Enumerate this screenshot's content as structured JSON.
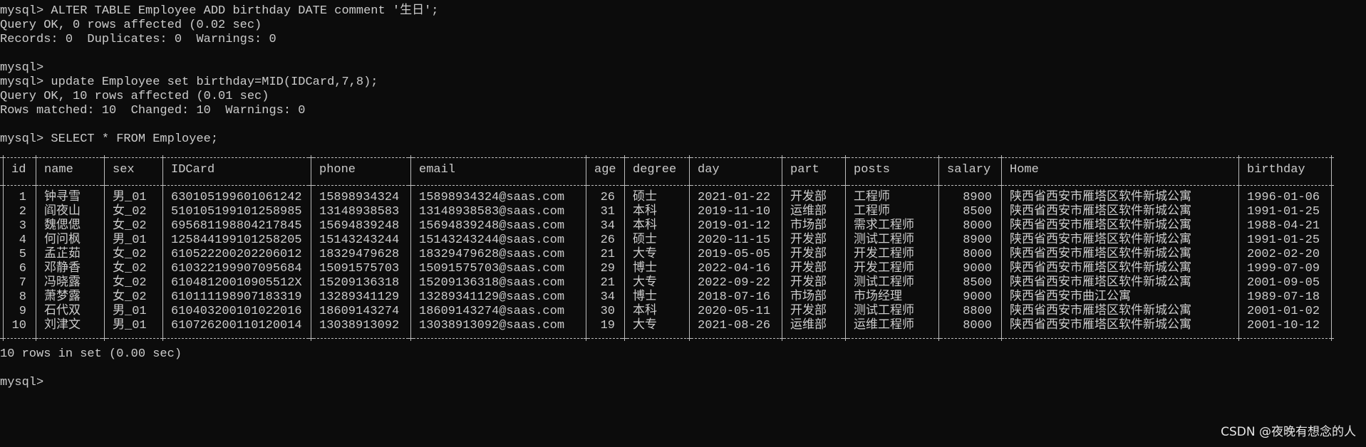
{
  "terminal": {
    "lines": [
      "mysql> ALTER TABLE Employee ADD birthday DATE comment '生日';",
      "Query OK, 0 rows affected (0.02 sec)",
      "Records: 0  Duplicates: 0  Warnings: 0",
      "",
      "mysql>",
      "mysql> update Employee set birthday=MID(IDCard,7,8);",
      "Query OK, 10 rows affected (0.01 sec)",
      "Rows matched: 10  Changed: 10  Warnings: 0",
      "",
      "mysql> SELECT * FROM Employee;"
    ],
    "result_summary": "10 rows in set (0.00 sec)",
    "final_prompt": "mysql>"
  },
  "table": {
    "columns": [
      "id",
      "name",
      "sex",
      "IDCard",
      "phone",
      "email",
      "age",
      "degree",
      "day",
      "part",
      "posts",
      "salary",
      "Home",
      "birthday"
    ],
    "rows": [
      [
        "1",
        "钟寻雪",
        "男_01",
        "630105199601061242",
        "15898934324",
        "15898934324@saas.com",
        "26",
        "硕士",
        "2021-01-22",
        "开发部",
        "工程师",
        "8900",
        "陕西省西安市雁塔区软件新城公寓",
        "1996-01-06"
      ],
      [
        "2",
        "阎夜山",
        "女_02",
        "510105199101258985",
        "13148938583",
        "13148938583@saas.com",
        "31",
        "本科",
        "2019-11-10",
        "运维部",
        "工程师",
        "8500",
        "陕西省西安市雁塔区软件新城公寓",
        "1991-01-25"
      ],
      [
        "3",
        "魏偲偲",
        "女_02",
        "695681198804217845",
        "15694839248",
        "15694839248@saas.com",
        "34",
        "本科",
        "2019-01-12",
        "市场部",
        "需求工程师",
        "8000",
        "陕西省西安市雁塔区软件新城公寓",
        "1988-04-21"
      ],
      [
        "4",
        "何问枫",
        "男_01",
        "125844199101258205",
        "15143243244",
        "15143243244@saas.com",
        "26",
        "硕士",
        "2020-11-15",
        "开发部",
        "测试工程师",
        "8900",
        "陕西省西安市雁塔区软件新城公寓",
        "1991-01-25"
      ],
      [
        "5",
        "孟芷茹",
        "女_02",
        "610522200202206012",
        "18329479628",
        "18329479628@saas.com",
        "21",
        "大专",
        "2019-05-05",
        "开发部",
        "开发工程师",
        "8000",
        "陕西省西安市雁塔区软件新城公寓",
        "2002-02-20"
      ],
      [
        "6",
        "邓静香",
        "女_02",
        "610322199907095684",
        "15091575703",
        "15091575703@saas.com",
        "29",
        "博士",
        "2022-04-16",
        "开发部",
        "开发工程师",
        "9000",
        "陕西省西安市雁塔区软件新城公寓",
        "1999-07-09"
      ],
      [
        "7",
        "冯晓露",
        "女_02",
        "61048120010905512X",
        "15209136318",
        "15209136318@saas.com",
        "21",
        "大专",
        "2022-09-22",
        "开发部",
        "测试工程师",
        "8500",
        "陕西省西安市雁塔区软件新城公寓",
        "2001-09-05"
      ],
      [
        "8",
        "萧梦露",
        "女_02",
        "610111198907183319",
        "13289341129",
        "13289341129@saas.com",
        "34",
        "博士",
        "2018-07-16",
        "市场部",
        "市场经理",
        "9000",
        "陕西省西安市曲江公寓",
        "1989-07-18"
      ],
      [
        "9",
        "石代双",
        "男_01",
        "610403200101022016",
        "18609143274",
        "18609143274@saas.com",
        "30",
        "本科",
        "2020-05-11",
        "开发部",
        "测试工程师",
        "8800",
        "陕西省西安市雁塔区软件新城公寓",
        "2001-01-02"
      ],
      [
        "10",
        "刘津文",
        "男_01",
        "610726200110120014",
        "13038913092",
        "13038913092@saas.com",
        "19",
        "大专",
        "2021-08-26",
        "运维部",
        "运维工程师",
        "8000",
        "陕西省西安市雁塔区软件新城公寓",
        "2001-10-12"
      ]
    ]
  },
  "watermark": "CSDN @夜晚有想念的人"
}
